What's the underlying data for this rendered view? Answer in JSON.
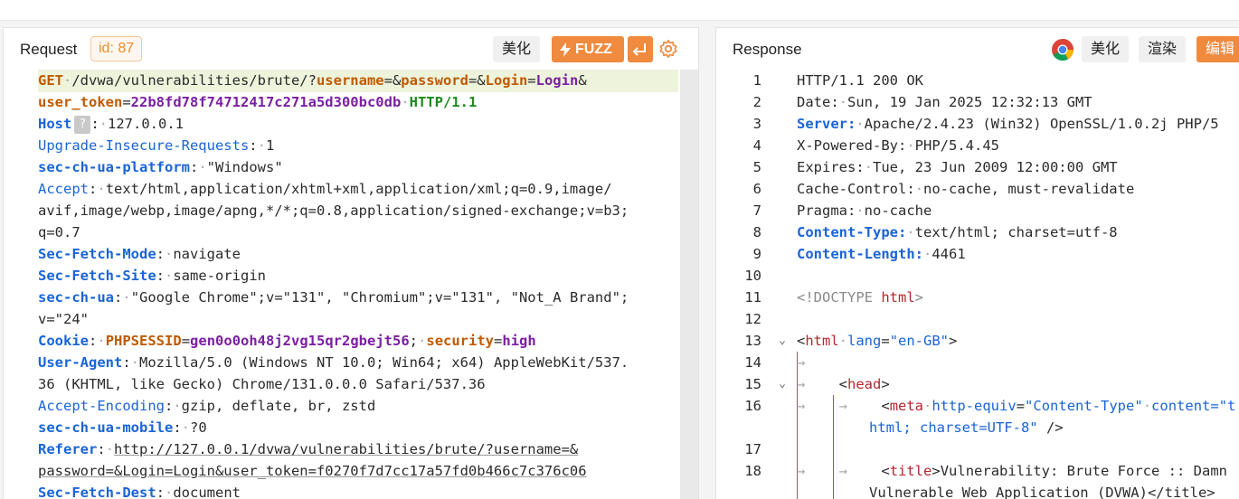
{
  "request": {
    "title": "Request",
    "id_badge": "id: 87",
    "beautify_label": "美化",
    "fuzz_label": "FUZZ",
    "lines": {
      "l1_method": "GET",
      "l1_path": "/dvwa/vulnerabilities/brute/?",
      "l1_p1": "username",
      "l1_p2": "password",
      "l1_p3": "Login",
      "l1_p3v": "Login",
      "l2_p": "user_token",
      "l2_v": "22b8fd78f74712417c271a5d300bc0db",
      "l2_proto": "HTTP/1.1",
      "host_k": "Host",
      "host_v": "127.0.0.1",
      "uir_k": "Upgrade-Insecure-Requests",
      "uir_v": "1",
      "plat_k": "sec-ch-ua-platform",
      "plat_v": "\"Windows\"",
      "acc_k": "Accept",
      "acc_v1": "text/html,application/xhtml+xml,application/xml;q=0.9,image/",
      "acc_v2": "avif,image/webp,image/apng,*/*;q=0.8,application/signed-exchange;v=b3;",
      "acc_v3": "q=0.7",
      "sfm_k": "Sec-Fetch-Mode",
      "sfm_v": "navigate",
      "sfs_k": "Sec-Fetch-Site",
      "sfs_v": "same-origin",
      "ua_k": "sec-ch-ua",
      "ua_v1": "\"Google Chrome\";v=\"131\", \"Chromium\";v=\"131\", \"Not_A Brand\";",
      "ua_v2": "v=\"24\"",
      "cookie_k": "Cookie",
      "cookie_n1": "PHPSESSID",
      "cookie_v1": "gen0o0oh48j2vg15qr2gbejt56",
      "cookie_n2": "security",
      "cookie_v2": "high",
      "uag_k": "User-Agent",
      "uag_v1": "Mozilla/5.0 (Windows NT 10.0; Win64; x64) AppleWebKit/537.",
      "uag_v2": "36 (KHTML, like Gecko) Chrome/131.0.0.0 Safari/537.36",
      "ae_k": "Accept-Encoding",
      "ae_v": "gzip, deflate, br, zstd",
      "mob_k": "sec-ch-ua-mobile",
      "mob_v": "?0",
      "ref_k": "Referer",
      "ref_v1": "http://127.0.0.1/dvwa/vulnerabilities/brute/?username=&",
      "ref_v2": "password=&Login=Login&user_token=f0270f7d7cc17a57fd0b466c7c376c06",
      "sfd_k": "Sec-Fetch-Dest",
      "sfd_v": "document"
    }
  },
  "response": {
    "title": "Response",
    "beautify_label": "美化",
    "render_label": "渲染",
    "edit_label": "编辑",
    "line_numbers": [
      "1",
      "2",
      "3",
      "4",
      "5",
      "6",
      "7",
      "8",
      "9",
      "10",
      "11",
      "12",
      "13",
      "14",
      "15",
      "16",
      "17",
      "18"
    ],
    "lines": {
      "r1": "HTTP/1.1 200 OK",
      "r2_k": "Date:",
      "r2_v": "Sun, 19 Jan 2025 12:32:13 GMT",
      "r3_k": "Server:",
      "r3_v": "Apache/2.4.23 (Win32) OpenSSL/1.0.2j PHP/5",
      "r4_k": "X-Powered-By:",
      "r4_v": "PHP/5.4.45",
      "r5_k": "Expires:",
      "r5_v": "Tue, 23 Jun 2009 12:00:00 GMT",
      "r6_k": "Cache-Control:",
      "r6_v": "no-cache, must-revalidate",
      "r7_k": "Pragma:",
      "r7_v": "no-cache",
      "r8_k": "Content-Type:",
      "r8_v": "text/html; charset=utf-8",
      "r9_k": "Content-Length:",
      "r9_v": "4461",
      "r11_a": "<!DOCTYPE ",
      "r11_b": "html",
      "r11_c": ">",
      "r13_tag": "html",
      "r13_attr": "lang",
      "r13_val": "\"en-GB\"",
      "r15_tag": "head",
      "r16_tag": "meta",
      "r16_a1": "http-equiv",
      "r16_v1": "\"Content-Type\"",
      "r16_a2": "content",
      "r16_v2": "=\"t",
      "r16b": "html; charset=UTF-8\"",
      "r16c": " />",
      "r18_tag": "title",
      "r18_txt": "Vulnerability: Brute Force :: Damn",
      "r18b": "Vulnerable Web Application (DVWA)</title>"
    }
  },
  "colors": {
    "accent": "#f08a3e",
    "key": "#1a64d6",
    "tag": "#b3262f",
    "param": "#c05a00"
  },
  "icons": [
    "lightning-icon",
    "return-icon",
    "gear-icon",
    "chrome-icon",
    "question-icon",
    "chevron-down-icon",
    "tab-arrow-icon"
  ]
}
